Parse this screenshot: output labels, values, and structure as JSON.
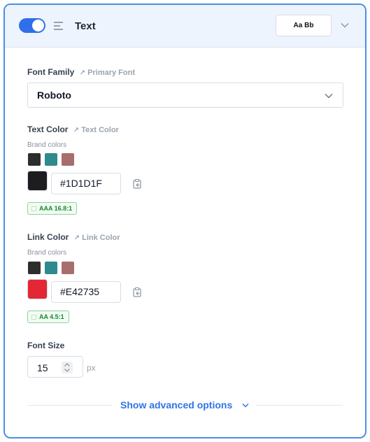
{
  "header": {
    "title": "Text",
    "toggle_on": true,
    "font_preview": "Aa Bb",
    "accent_color": "#2f6fea"
  },
  "font_family": {
    "label": "Font Family",
    "link_text": "Primary Font",
    "selected": "Roboto"
  },
  "text_color": {
    "label": "Text Color",
    "link_text": "Text Color",
    "brand_label": "Brand colors",
    "value": "#1D1D1F",
    "contrast": "AAA 16.8:1"
  },
  "link_color": {
    "label": "Link Color",
    "link_text": "Link Color",
    "brand_label": "Brand colors",
    "value": "#E42735",
    "contrast": "AA 4.5:1"
  },
  "brand_colors": [
    "#2d2d2d",
    "#2e8a8f",
    "#a86e6e"
  ],
  "font_size": {
    "label": "Font Size",
    "value": "15",
    "unit": "px"
  },
  "advanced": {
    "label": "Show advanced options"
  },
  "icons": {
    "align": "align-left-icon",
    "chevron": "chevron-down-icon",
    "link": "link-arrow-icon",
    "clipboard": "clipboard-paste-icon"
  }
}
